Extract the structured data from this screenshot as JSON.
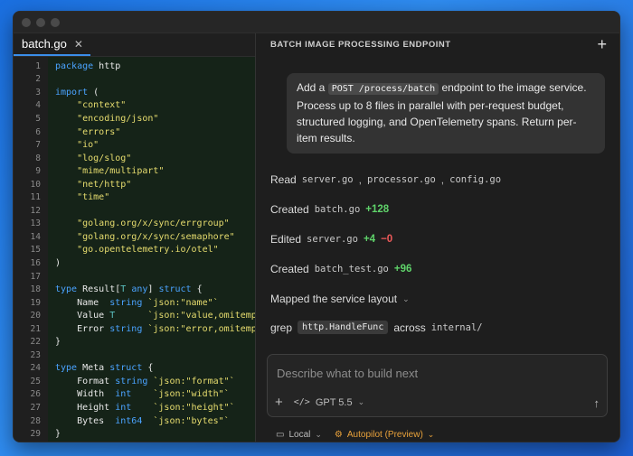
{
  "editor": {
    "tab_label": "batch.go",
    "lines": [
      {
        "n": "1",
        "segs": [
          [
            "kw",
            "package"
          ],
          [
            "t",
            " http"
          ]
        ]
      },
      {
        "n": "2",
        "segs": []
      },
      {
        "n": "3",
        "segs": [
          [
            "kw",
            "import"
          ],
          [
            "t",
            " ("
          ]
        ]
      },
      {
        "n": "4",
        "segs": [
          [
            "t",
            "    "
          ],
          [
            "str",
            "\"context\""
          ]
        ]
      },
      {
        "n": "5",
        "segs": [
          [
            "t",
            "    "
          ],
          [
            "str",
            "\"encoding/json\""
          ]
        ]
      },
      {
        "n": "6",
        "segs": [
          [
            "t",
            "    "
          ],
          [
            "str",
            "\"errors\""
          ]
        ]
      },
      {
        "n": "7",
        "segs": [
          [
            "t",
            "    "
          ],
          [
            "str",
            "\"io\""
          ]
        ]
      },
      {
        "n": "8",
        "segs": [
          [
            "t",
            "    "
          ],
          [
            "str",
            "\"log/slog\""
          ]
        ]
      },
      {
        "n": "9",
        "segs": [
          [
            "t",
            "    "
          ],
          [
            "str",
            "\"mime/multipart\""
          ]
        ]
      },
      {
        "n": "10",
        "segs": [
          [
            "t",
            "    "
          ],
          [
            "str",
            "\"net/http\""
          ]
        ]
      },
      {
        "n": "11",
        "segs": [
          [
            "t",
            "    "
          ],
          [
            "str",
            "\"time\""
          ]
        ]
      },
      {
        "n": "12",
        "segs": []
      },
      {
        "n": "13",
        "segs": [
          [
            "t",
            "    "
          ],
          [
            "str",
            "\"golang.org/x/sync/errgroup\""
          ]
        ]
      },
      {
        "n": "14",
        "segs": [
          [
            "t",
            "    "
          ],
          [
            "str",
            "\"golang.org/x/sync/semaphore\""
          ]
        ]
      },
      {
        "n": "15",
        "segs": [
          [
            "t",
            "    "
          ],
          [
            "str",
            "\"go.opentelemetry.io/otel\""
          ]
        ]
      },
      {
        "n": "16",
        "segs": [
          [
            "t",
            ")"
          ]
        ]
      },
      {
        "n": "17",
        "segs": []
      },
      {
        "n": "18",
        "segs": [
          [
            "kw",
            "type"
          ],
          [
            "t",
            " Result["
          ],
          [
            "ty",
            "T"
          ],
          [
            "t",
            " "
          ],
          [
            "kw",
            "any"
          ],
          [
            "t",
            "] "
          ],
          [
            "kw",
            "struct"
          ],
          [
            "t",
            " {"
          ]
        ]
      },
      {
        "n": "19",
        "segs": [
          [
            "t",
            "    Name  "
          ],
          [
            "kw",
            "string"
          ],
          [
            "t",
            " "
          ],
          [
            "str",
            "`json:\"name\"`"
          ]
        ]
      },
      {
        "n": "20",
        "segs": [
          [
            "t",
            "    Value "
          ],
          [
            "ty",
            "T"
          ],
          [
            "t",
            "      "
          ],
          [
            "str",
            "`json:\"value,omitempty\"`"
          ]
        ]
      },
      {
        "n": "21",
        "segs": [
          [
            "t",
            "    Error "
          ],
          [
            "kw",
            "string"
          ],
          [
            "t",
            " "
          ],
          [
            "str",
            "`json:\"error,omitempty\"`"
          ]
        ]
      },
      {
        "n": "22",
        "segs": [
          [
            "t",
            "}"
          ]
        ]
      },
      {
        "n": "23",
        "segs": []
      },
      {
        "n": "24",
        "segs": [
          [
            "kw",
            "type"
          ],
          [
            "t",
            " Meta "
          ],
          [
            "kw",
            "struct"
          ],
          [
            "t",
            " {"
          ]
        ]
      },
      {
        "n": "25",
        "segs": [
          [
            "t",
            "    Format "
          ],
          [
            "kw",
            "string"
          ],
          [
            "t",
            " "
          ],
          [
            "str",
            "`json:\"format\"`"
          ]
        ]
      },
      {
        "n": "26",
        "segs": [
          [
            "t",
            "    Width  "
          ],
          [
            "kw",
            "int"
          ],
          [
            "t",
            "    "
          ],
          [
            "str",
            "`json:\"width\"`"
          ]
        ]
      },
      {
        "n": "27",
        "segs": [
          [
            "t",
            "    Height "
          ],
          [
            "kw",
            "int"
          ],
          [
            "t",
            "    "
          ],
          [
            "str",
            "`json:\"height\"`"
          ]
        ]
      },
      {
        "n": "28",
        "segs": [
          [
            "t",
            "    Bytes  "
          ],
          [
            "kw",
            "int64"
          ],
          [
            "t",
            "  "
          ],
          [
            "str",
            "`json:\"bytes\"`"
          ]
        ]
      },
      {
        "n": "29",
        "segs": [
          [
            "t",
            "}"
          ]
        ]
      }
    ]
  },
  "chat": {
    "title": "BATCH IMAGE PROCESSING ENDPOINT",
    "prompt": {
      "pre": "Add a",
      "code": "POST /process/batch",
      "post": "endpoint to the image service. Process up to 8 files in parallel with per-request budget, structured logging, and OpenTelemetry spans. Return per-item results."
    },
    "read": {
      "label": "Read",
      "files": [
        "server.go",
        "processor.go",
        "config.go"
      ],
      "sep": ","
    },
    "created1": {
      "label": "Created",
      "file": "batch.go",
      "add": "+128"
    },
    "edited": {
      "label": "Edited",
      "file": "server.go",
      "add": "+4",
      "del": "−0"
    },
    "created2": {
      "label": "Created",
      "file": "batch_test.go",
      "add": "+96"
    },
    "mapped": {
      "label": "Mapped the service layout"
    },
    "grep": {
      "label": "grep",
      "chip": "http.HandleFunc",
      "across": "across",
      "path": "internal/"
    }
  },
  "composer": {
    "placeholder": "Describe what to build next",
    "model": "GPT 5.5"
  },
  "footer": {
    "local": "Local",
    "autopilot": "Autopilot (Preview)"
  }
}
